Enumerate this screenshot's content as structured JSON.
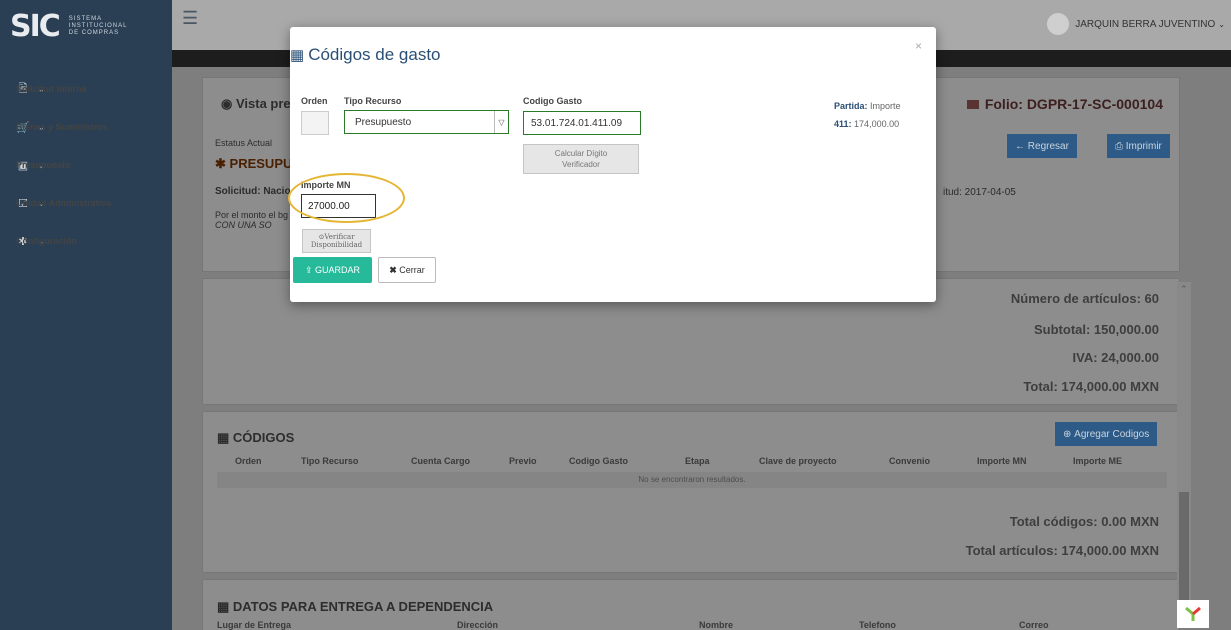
{
  "brand": {
    "logo": "SIC",
    "line1": "SISTEMA",
    "line2": "INSTITUCIONAL",
    "line3": "DE COMPRAS"
  },
  "sidebar": {
    "items": [
      {
        "label": "Solicitud Interna",
        "icon": "document-icon"
      },
      {
        "label": "Bienes y Suministros",
        "icon": "cart-icon"
      },
      {
        "label": "Presupuesto",
        "icon": "money-icon"
      },
      {
        "label": "Unidad Administrativa",
        "icon": "checkbox-icon"
      },
      {
        "label": "Configuración",
        "icon": "gear-icon"
      }
    ]
  },
  "topbar": {
    "user_name": "JARQUIN BERRA JUVENTINO"
  },
  "page": {
    "vista_title": "Vista previ",
    "folio": "Folio: DGPR-17-SC-000104",
    "estatus_label": "Estatus Actual",
    "estatus_value": "PRESUPU",
    "solicitud": "Solicitud: Nacio",
    "fecha": "itud: 2017-04-05",
    "nota_line1": "Por el monto el bg",
    "nota_line2": "CON UNA SO",
    "regresar_label": "Regresar",
    "imprimir_label": "Imprimir"
  },
  "totals": {
    "articulos": "Número de artículos: 60",
    "subtotal": "Subtotal: 150,000.00",
    "iva": "IVA: 24,000.00",
    "total": "Total: 174,000.00 MXN"
  },
  "codigos": {
    "title": "CÓDIGOS",
    "add_label": "Agregar Codigos",
    "columns": [
      "Orden",
      "Tipo Recurso",
      "Cuenta Cargo",
      "Previo",
      "Codigo Gasto",
      "Etapa",
      "Clave de proyecto",
      "Convenio",
      "Importe MN",
      "Importe ME"
    ],
    "empty_text": "No se encontraron resultados.",
    "total_codigos": "Total códigos: 0.00 MXN",
    "total_articulos": "Total artículos: 174,000.00 MXN"
  },
  "entrega": {
    "title": "DATOS PARA ENTREGA A DEPENDENCIA",
    "columns": [
      "Lugar de Entrega",
      "Dirección",
      "Nombre",
      "Telefono",
      "Correo"
    ]
  },
  "modal": {
    "title": "Códigos de gasto",
    "close": "×",
    "orden_label": "Orden",
    "tipo_label": "Tipo Recurso",
    "tipo_value": "Presupuesto",
    "codigo_label": "Codigo Gasto",
    "codigo_value": "53.01.724.01.411.09",
    "calc_line1": "Calcular Dígito",
    "calc_line2": "Verificador",
    "partida_label": "Partida:",
    "partida_value": "Importe",
    "partida_code": "411:",
    "partida_amount": "174,000.00",
    "importe_label": "Importe MN",
    "importe_value": "27000.00",
    "verificar_line1": "Verificar",
    "verificar_line2": "Disponibilidad",
    "guardar_label": "GUARDAR",
    "cerrar_label": "Cerrar"
  },
  "colors": {
    "sidebar": "#2a3f54",
    "primary": "#2a4f74",
    "success": "#26b99a",
    "highlight": "#e5b633"
  }
}
